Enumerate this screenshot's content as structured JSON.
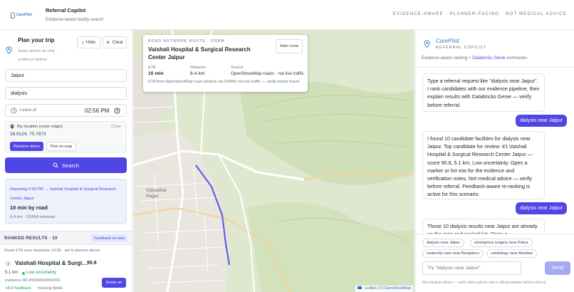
{
  "header": {
    "logo_text": "CarePilot",
    "title": "Referral Copilot",
    "subtitle": "Evidence-aware facility search",
    "tagline": "EVIDENCE-AWARE · PLANNER-FACING · NOT MEDICAL ADVICE"
  },
  "planner": {
    "title": "Plan your trip",
    "sub_line1": "Same search as chat ·",
    "sub_line2": "evidence-ranked",
    "hide_label": "Hide",
    "clear_label": "Clear",
    "location_value": "Jaipur",
    "query_value": "dialysis",
    "leave_label": "Leave at",
    "leave_time": "02:56 PM",
    "my_location_label": "My location (route origin)",
    "clear_location_label": "Clear",
    "coords": "26.9124, 75.7873",
    "random_demo_label": "Random demo",
    "pick_map_label": "Pick on map",
    "search_label": "Search"
  },
  "route_summary": {
    "departing_line1": "Departing 2:56 PM → Vaishali Hospital & Surgical Research",
    "departing_line2": "Center Jaipur",
    "duration": "10 min by road",
    "detail": "8.4 km · OSRM estimate"
  },
  "ranked": {
    "title": "RANKED RESULTS · 10",
    "badge": "Feedback re-rank",
    "note": "Route ETA uses departure 14:56 · set in planner above"
  },
  "results": [
    {
      "rank": "1",
      "name": "Vaishali Hospital & Surgi…",
      "score": "90.8",
      "distance": "5.1 km",
      "uncertainty": "Low uncertainty",
      "evidence": "evidence 80.00000000000001",
      "feedback": "+8.0 feedback",
      "missing": "missing fields",
      "route_button": "Route on"
    }
  ],
  "map_card": {
    "eyebrow": "ROAD NETWORK ROUTE · OSRM",
    "facility": "Vaishali Hospital & Surgical Research Center Jaipur",
    "hide_route": "Hide route",
    "eta_label": "ETA",
    "eta_value": "10 min",
    "distance_label": "Distance",
    "distance_value": "8.4 km",
    "source_label": "Source",
    "source_value": "OpenStreetMap roads · not live traffic",
    "footnote": "ETA from OpenStreetMap road network via OSRM; not live traffic — verify before travel."
  },
  "map": {
    "labels": [
      "Vidyadhar Nagar"
    ],
    "attribution_leaflet": "Leaflet",
    "attribution_osm": "OpenStreetMap"
  },
  "chat": {
    "title": "CarePilot",
    "subtitle": "REFERRAL COPILOT",
    "note_prefix": "Evidence-aware ranking + ",
    "note_link": "Databricks Genie",
    "note_suffix": " summaries",
    "messages": [
      {
        "role": "bot",
        "text": "Type a referral request like \"dialysis near Jaipur\". I rank candidates with our evidence pipeline, then explain results with Databricks Genie — verify before referral."
      },
      {
        "role": "user",
        "text": "dialysis near Jaipur"
      },
      {
        "role": "bot",
        "text": "I found 10 candidate facilities for dialysis near Jaipur. Top candidate for review: #1 Vaishali Hospital & Surgical Research Center Jaipur — score 90.8, 5.1 km, Low uncertainty. Open a marker or list row for the evidence and verification notes. Not medical advice — verify before referral. Feedback-aware re-ranking is active for this scenario."
      },
      {
        "role": "user",
        "text": "dialysis near Jaipur"
      },
      {
        "role": "bot",
        "text": "Those 10 dialysis results near Jaipur are already on the map and ranked list. Open a"
      }
    ],
    "chips": [
      "dialysis near Jaipur",
      "emergency surgery near Patna",
      "maternity care near Bengaluru",
      "cardiology near Mumbai"
    ],
    "input_placeholder": "Try \"dialysis near Jaipur\"",
    "send_label": "Send",
    "disclaimer": "Not medical advice — verify with a phone call or official website before referral."
  },
  "colors": {
    "accent": "#4f46e5",
    "green": "#22c55e",
    "map_land": "#dfe7cf"
  }
}
